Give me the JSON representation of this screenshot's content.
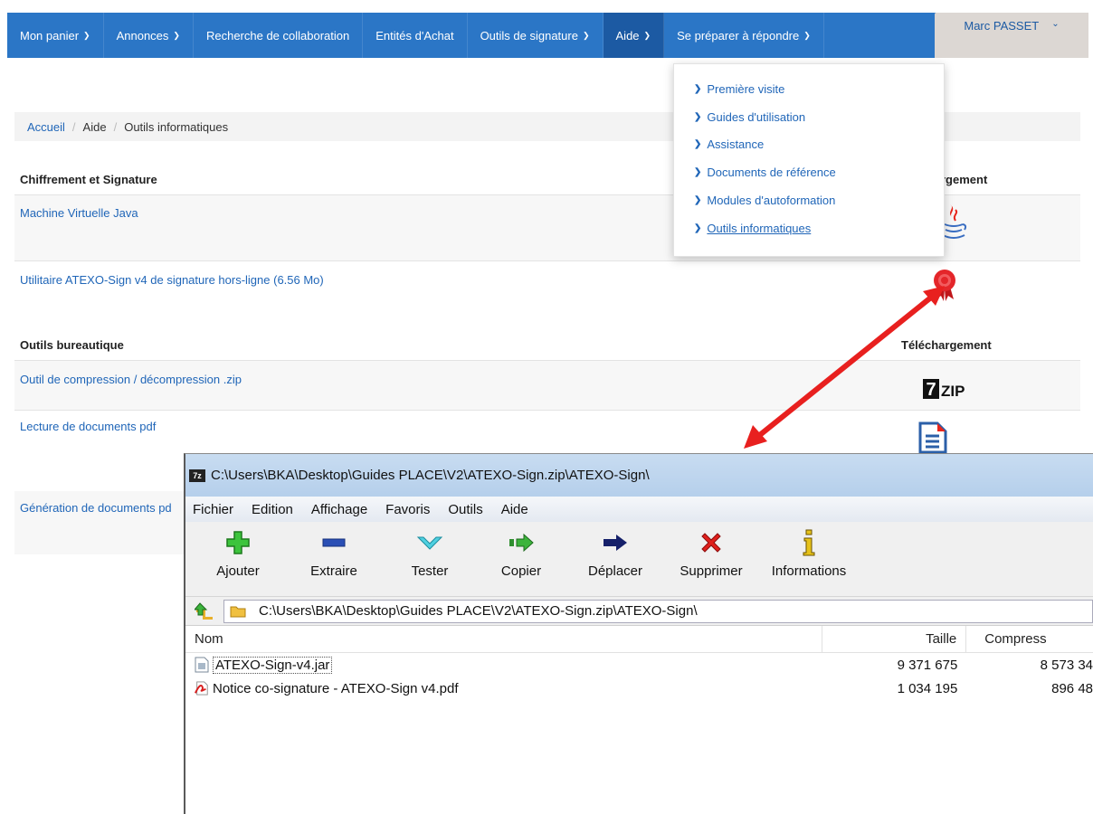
{
  "nav": {
    "items": [
      {
        "label": "Mon panier",
        "caret": true
      },
      {
        "label": "Annonces",
        "caret": true
      },
      {
        "label": "Recherche de collaboration",
        "caret": false
      },
      {
        "label": "Entités d'Achat",
        "caret": false
      },
      {
        "label": "Outils de signature",
        "caret": true
      },
      {
        "label": "Aide",
        "caret": true
      },
      {
        "label": "Se préparer à répondre",
        "caret": true
      }
    ],
    "user": "Marc PASSET",
    "accent": "#2b76c6",
    "active_color": "#1c5aa3"
  },
  "dropdown": {
    "items": [
      "Première visite",
      "Guides d'utilisation",
      "Assistance",
      "Documents de référence",
      "Modules d'autoformation",
      "Outils informatiques"
    ]
  },
  "breadcrumb": {
    "home": "Accueil",
    "parent": "Aide",
    "current": "Outils informatiques"
  },
  "section1": {
    "title": "Chiffrement et Signature",
    "download_header_partial": "rgement",
    "rows": [
      {
        "label": "Machine Virtuelle Java",
        "icon": "java-icon"
      },
      {
        "label": "Utilitaire ATEXO-Sign v4 de signature hors-ligne (6.56 Mo)",
        "icon": "certificate-rosette-icon"
      }
    ]
  },
  "section2": {
    "title": "Outils bureautique",
    "download_header": "Téléchargement",
    "rows": [
      {
        "label": "Outil de compression / décompression .zip",
        "icon": "7zip-icon"
      },
      {
        "label": "Lecture de documents pdf",
        "icon": "pdf-document-icon"
      },
      {
        "label": "Génération de documents pd",
        "icon": ""
      }
    ]
  },
  "zip_window": {
    "title": "C:\\Users\\BKA\\Desktop\\Guides PLACE\\V2\\ATEXO-Sign.zip\\ATEXO-Sign\\",
    "app_icon_text": "7z",
    "menu": [
      "Fichier",
      "Edition",
      "Affichage",
      "Favoris",
      "Outils",
      "Aide"
    ],
    "toolbar": [
      {
        "label": "Ajouter",
        "icon": "add-plus-icon"
      },
      {
        "label": "Extraire",
        "icon": "extract-minus-icon"
      },
      {
        "label": "Tester",
        "icon": "test-check-icon"
      },
      {
        "label": "Copier",
        "icon": "copy-arrow-icon"
      },
      {
        "label": "Déplacer",
        "icon": "move-arrow-icon"
      },
      {
        "label": "Supprimer",
        "icon": "delete-x-icon"
      },
      {
        "label": "Informations",
        "icon": "info-icon"
      }
    ],
    "address": "C:\\Users\\BKA\\Desktop\\Guides PLACE\\V2\\ATEXO-Sign.zip\\ATEXO-Sign\\",
    "columns": {
      "name": "Nom",
      "size": "Taille",
      "compressed": "Compress"
    },
    "files": [
      {
        "name": "ATEXO-Sign-v4.jar",
        "size": "9 371 675",
        "compressed": "8 573 34",
        "icon": "jar-file-icon"
      },
      {
        "name": "Notice co-signature - ATEXO-Sign v4.pdf",
        "size": "1 034 195",
        "compressed": "896 48",
        "icon": "pdf-file-icon"
      }
    ]
  },
  "annotation_color": "#e8201f"
}
